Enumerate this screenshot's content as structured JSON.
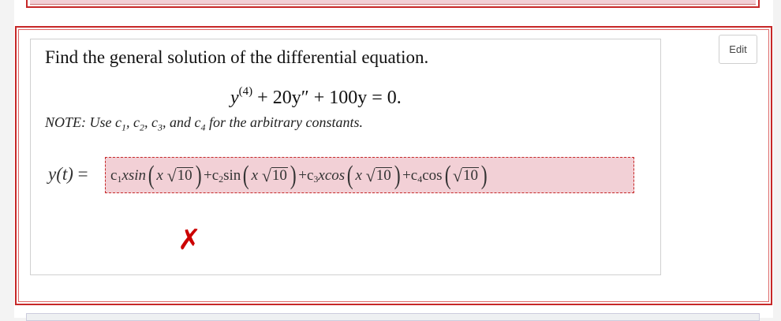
{
  "edit_button": {
    "label": "Edit"
  },
  "question": {
    "prompt": "Find the general solution of the differential equation.",
    "equation": {
      "y": "y",
      "order": "(4)",
      "rest": " + 20y″ + 100y = 0."
    },
    "note_prefix": "NOTE: Use ",
    "constants": [
      "c",
      "c",
      "c",
      "c"
    ],
    "constant_subs": [
      "1",
      "2",
      "3",
      "4"
    ],
    "note_mid1": ", ",
    "note_and": ", and ",
    "note_suffix": " for the arbitrary constants."
  },
  "answer": {
    "label_func": "y(t)",
    "label_eq": " =",
    "terms": {
      "c1": "c",
      "c1_sub": "1",
      "t1": " xsin",
      "x1": "x",
      "r1": "10",
      "plus1": " + ",
      "c2": "c",
      "c2_sub": "2",
      "t2": " sin",
      "x2": "x",
      "r2": "10",
      "plus2": " + ",
      "c3": "c",
      "c3_sub": "3",
      "t3": " xcos",
      "x3": "x",
      "r3": "10",
      "plus3": " + ",
      "c4": "c",
      "c4_sub": "4",
      "t4": "cos",
      "r4": "10"
    },
    "status": "incorrect",
    "status_color": "#cc0000"
  },
  "icons": {
    "incorrect": "cross-mark-icon",
    "incorrect_glyph": "✗"
  }
}
